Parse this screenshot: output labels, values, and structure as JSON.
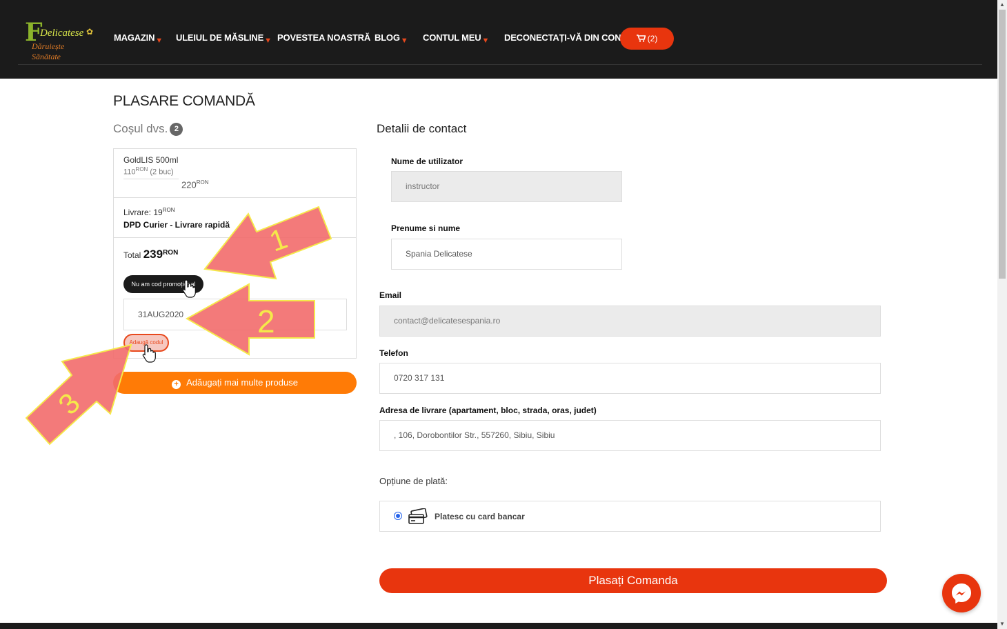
{
  "header": {
    "logo": {
      "letter": "F",
      "name": "Delicatese",
      "tagline": "Dăruiește Sănătate"
    },
    "nav": [
      {
        "label": "MAGAZIN",
        "dropdown": true
      },
      {
        "label": "ULEIUL DE MĂSLINE",
        "dropdown": true
      },
      {
        "label": "POVESTEA NOASTRĂ",
        "dropdown": false
      },
      {
        "label": "BLOG",
        "dropdown": true
      },
      {
        "label": "CONTUL MEU",
        "dropdown": true
      },
      {
        "label": "DECONECTAȚI-VĂ DIN CONT",
        "dropdown": false
      }
    ],
    "cart": {
      "label": "(2)",
      "icon": "cart-icon"
    }
  },
  "page": {
    "title": "PLASARE COMANDĂ"
  },
  "cart": {
    "heading": "Coșul dvs.",
    "count": "2",
    "product": {
      "name": "GoldLIS 500ml",
      "unit_price": "110",
      "currency": "RON",
      "qty_text": "(2 buc)",
      "line_total": "220"
    },
    "shipping": {
      "label": "Livrare: 19",
      "currency": "RON",
      "carrier": "DPD Curier - Livrare rapidă"
    },
    "total": {
      "label": "Total",
      "value": "239",
      "currency": "RON"
    },
    "promo": {
      "toggle_label": "Nu am cod promoțional",
      "code_value": "31AUG2020",
      "apply_label": "Adaugă codul"
    },
    "add_more_label": "Adăugați mai multe produse"
  },
  "contact": {
    "heading": "Detalii de contact",
    "username_label": "Nume de utilizator",
    "username_value": "instructor",
    "fullname_label": "Prenume si nume",
    "fullname_value": "Spania Delicatese",
    "email_label": "Email",
    "email_value": "contact@delicatesespania.ro",
    "phone_label": "Telefon",
    "phone_value": "0720 317 131",
    "address_label": "Adresa de livrare (apartament, bloc, strada, oras, judet)",
    "address_value": ", 106, Dorobontilor Str., 557260, Sibiu, Sibiu",
    "payment_label": "Opțiune de plată:",
    "payment_option": "Platesc cu card bancar",
    "payment_selected": true,
    "place_order_label": "Plasați Comanda"
  },
  "annotations": [
    {
      "number": "1"
    },
    {
      "number": "2"
    },
    {
      "number": "3"
    }
  ],
  "colors": {
    "header_bg": "#1b1b1b",
    "accent_red": "#e8350e",
    "accent_orange": "#ff7b06",
    "arrow_fill": "#f26b6b",
    "arrow_outline": "#f5e94a"
  }
}
